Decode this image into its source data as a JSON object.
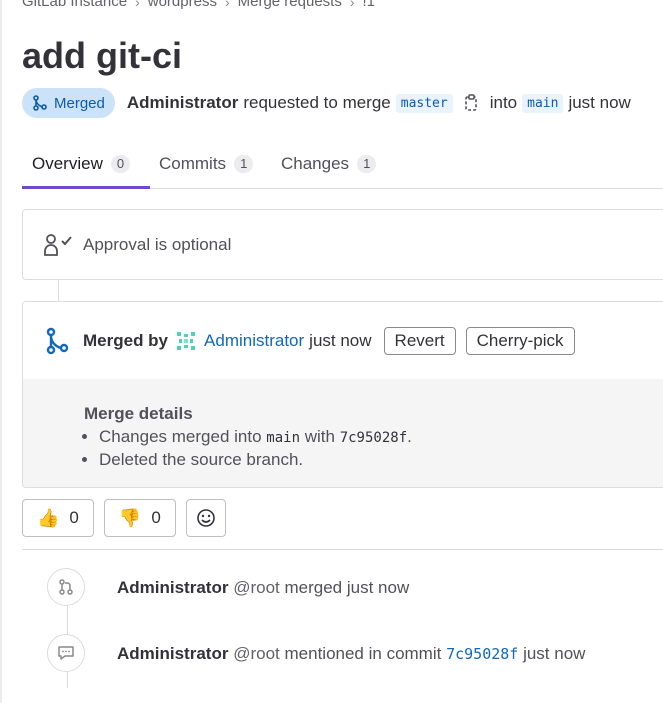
{
  "breadcrumb": {
    "items": [
      "GitLab Instance",
      "wordpress",
      "Merge requests",
      "!1"
    ],
    "separator": ">"
  },
  "title": "add git-ci",
  "status": {
    "badge": "Merged",
    "author": "Administrator",
    "requested_text": "requested to merge",
    "source_branch": "master",
    "into_text": "into",
    "target_branch": "main",
    "time": "just now"
  },
  "tabs": [
    {
      "label": "Overview",
      "count": "0"
    },
    {
      "label": "Commits",
      "count": "1"
    },
    {
      "label": "Changes",
      "count": "1"
    }
  ],
  "approval": {
    "text": "Approval is optional"
  },
  "merged_widget": {
    "merged_by_label": "Merged by",
    "user": "Administrator",
    "time": "just now",
    "revert_label": "Revert",
    "cherry_pick_label": "Cherry-pick",
    "details_title": "Merge details",
    "line1_prefix": "Changes merged into",
    "line1_branch": "main",
    "line1_with": "with",
    "line1_commit": "7c95028f",
    "line1_suffix": ".",
    "line2": "Deleted the source branch."
  },
  "reactions": {
    "thumbs_up_count": "0",
    "thumbs_down_count": "0"
  },
  "activity": [
    {
      "name": "Administrator",
      "handle": "@root",
      "text": "merged just now"
    },
    {
      "name": "Administrator",
      "handle": "@root",
      "text": "mentioned in commit",
      "commit": "7c95028f",
      "time": "just now"
    }
  ],
  "colors": {
    "accent": "#6e49cb",
    "link": "#1068bf",
    "merged_badge_bg": "#cbe2f9"
  }
}
